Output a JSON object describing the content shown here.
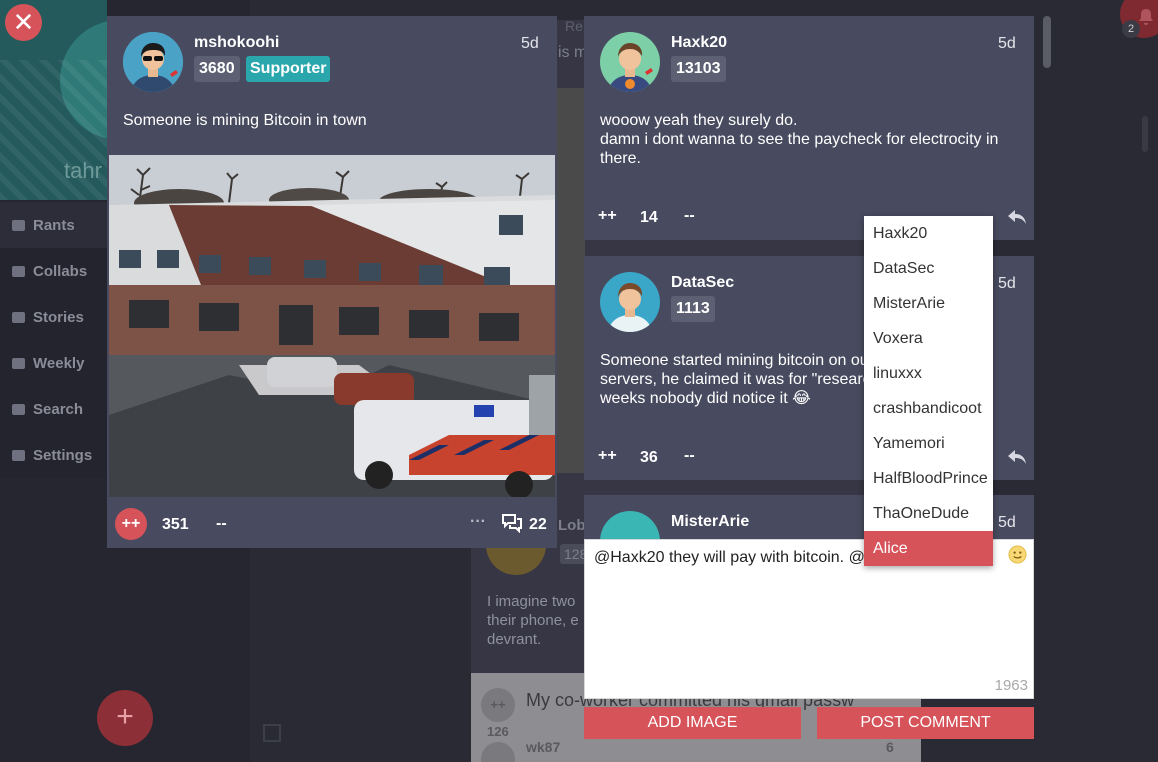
{
  "sidebar": {
    "username": "tahr",
    "items": [
      {
        "label": "Rants",
        "icon": "rants-icon"
      },
      {
        "label": "Collabs",
        "icon": "collabs-icon"
      },
      {
        "label": "Stories",
        "icon": "stories-icon"
      },
      {
        "label": "Weekly",
        "icon": "weekly-icon"
      },
      {
        "label": "Search",
        "icon": "search-icon"
      },
      {
        "label": "Settings",
        "icon": "settings-icon"
      }
    ],
    "fab_label": "+"
  },
  "background": {
    "re_label": "Re",
    "is_fragment": "is m",
    "post_text": "I imagine two their phone, e devrant.",
    "post_user": "Lobldu",
    "post_score": "128",
    "light_card": {
      "vote_plus": "++",
      "count": "126",
      "text": "My co-worker committed his gmail passw",
      "user": "wk87",
      "comments": "6"
    },
    "notification_count": "2"
  },
  "close_label": "✕",
  "main_post": {
    "username": "mshokoohi",
    "score": "3680",
    "badge": "Supporter",
    "time": "5d",
    "text": "Someone is mining Bitcoin in town",
    "vote_plus": "++",
    "votes": "351",
    "vote_minus": "--",
    "more": "···",
    "comments": "22"
  },
  "comments": [
    {
      "username": "Haxk20",
      "score": "13103",
      "time": "5d",
      "text": [
        "wooow yeah they surely do.",
        "damn i dont wanna to see the paycheck for electrocity in",
        "there."
      ],
      "vote_plus": "++",
      "votes": "14",
      "vote_minus": "--"
    },
    {
      "username": "DataSec",
      "score": "1113",
      "time": "5d",
      "text": [
        "Someone started mining bitcoin on ou",
        "servers, he claimed it was for \"researc",
        "weeks nobody did notice it 😂"
      ],
      "vote_plus": "++",
      "votes": "36",
      "vote_minus": "--"
    },
    {
      "username": "MisterArie",
      "time": "5d"
    }
  ],
  "composer": {
    "value": "@Haxk20 they will pay with bitcoin. @",
    "char_count": "1963",
    "add_image": "ADD IMAGE",
    "post_comment": "POST COMMENT"
  },
  "mentions": [
    "Haxk20",
    "DataSec",
    "MisterArie",
    "Voxera",
    "linuxxx",
    "crashbandicoot",
    "Yamemori",
    "HalfBloodPrince",
    "ThaOneDude",
    "Alice"
  ],
  "mention_selected": "Alice",
  "colors": {
    "accent": "#d55359",
    "card": "#484a5f",
    "supporter": "#2aa7ad",
    "background": "#2a2a35"
  }
}
